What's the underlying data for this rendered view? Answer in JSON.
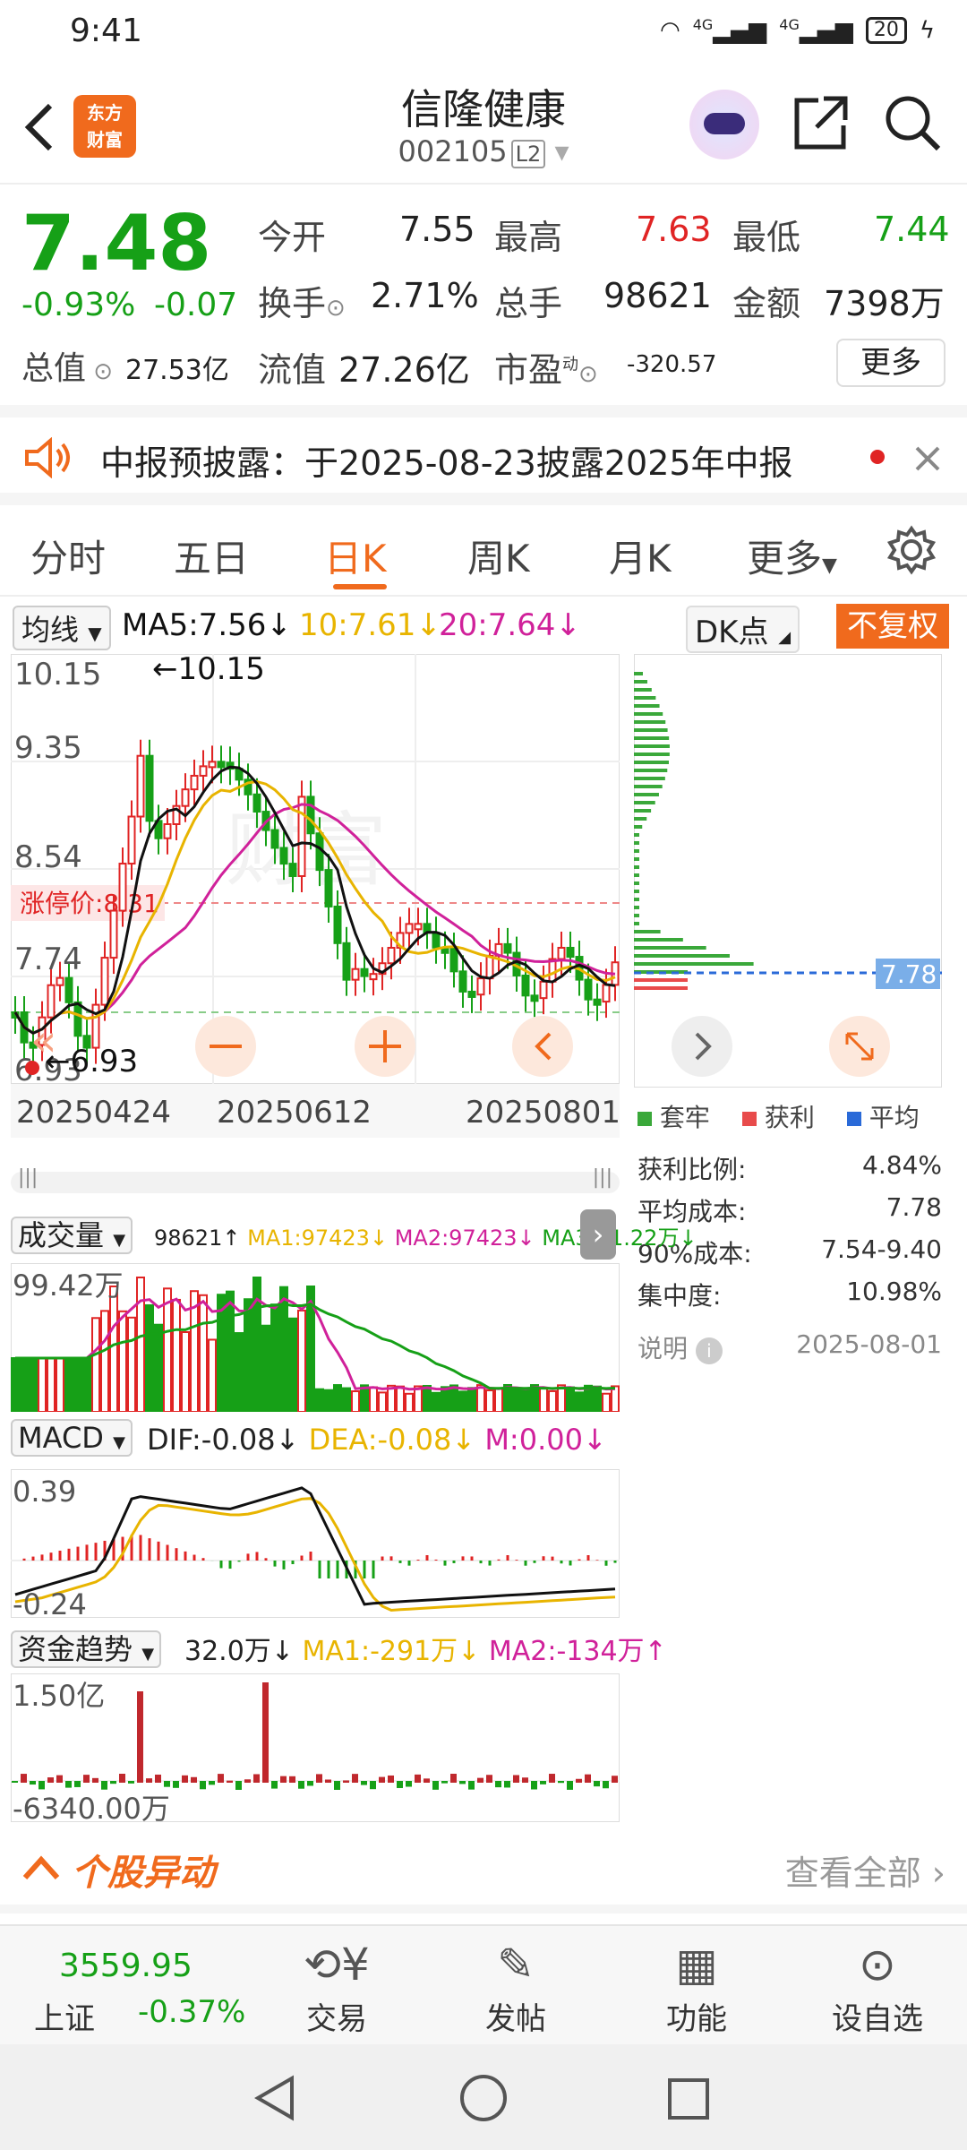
{
  "status": {
    "time": "9:41",
    "net1": "4G",
    "net2": "4G",
    "battery": "20"
  },
  "header": {
    "title": "信隆健康",
    "code": "002105",
    "level": "L2",
    "logo": "东方\n财富"
  },
  "quote": {
    "price": "7.48",
    "change_pct": "-0.93%",
    "change": "-0.07",
    "open_label": "今开",
    "open": "7.55",
    "high_label": "最高",
    "high": "7.63",
    "low_label": "最低",
    "low": "7.44",
    "turnover_label": "换手",
    "turnover": "2.71%",
    "volume_label": "总手",
    "volume": "98621",
    "amount_label": "金额",
    "amount": "7398万",
    "mktcap_label": "总值",
    "mktcap": "27.53亿",
    "float_label": "流值",
    "float": "27.26亿",
    "pe_label": "市盈",
    "pe_sup": "动",
    "pe": "-320.57",
    "more": "更多"
  },
  "notice": {
    "text": "中报预披露：于2025-08-23披露2025年中报"
  },
  "tabs": [
    "分时",
    "五日",
    "日K",
    "周K",
    "月K",
    "更多"
  ],
  "tab_active": 2,
  "kline": {
    "ma_selector": "均线",
    "ma5": "MA5:7.56↓",
    "ma10": "10:7.61↓",
    "ma20": "20:7.64↓",
    "dk": "DK点",
    "fq": "不复权",
    "y_labels": [
      "10.15",
      "9.35",
      "8.54",
      "7.74",
      "6.93"
    ],
    "max_marker": "←10.15",
    "min_marker": "←6.93",
    "limit_label": "涨停价:8.31",
    "dates": [
      "20250424",
      "20250612",
      "20250801"
    ],
    "watermark": "财富"
  },
  "chip": {
    "price_tag": "7.78",
    "legend": [
      "套牢",
      "获利",
      "平均"
    ],
    "rows": [
      {
        "label": "获利比例:",
        "value": "4.84%"
      },
      {
        "label": "平均成本:",
        "value": "7.78"
      },
      {
        "label": "90%成本:",
        "value": "7.54-9.40"
      },
      {
        "label": "集中度:",
        "value": "10.98%"
      }
    ],
    "note": "说明",
    "date": "2025-08-01"
  },
  "volume": {
    "selector": "成交量",
    "val": "98621↑",
    "ma1": "MA1:97423↓",
    "ma2": "MA2:97423↓",
    "ma3": "MA3:11.22万↓",
    "y_label": "99.42万"
  },
  "macd": {
    "selector": "MACD",
    "dif": "DIF:-0.08↓",
    "dea": "DEA:-0.08↓",
    "m": "M:0.00↓",
    "y_top": "0.39",
    "y_bottom": "-0.24"
  },
  "fund": {
    "selector": "资金趋势",
    "val": "32.0万↓",
    "ma1": "MA1:-291万↓",
    "ma2": "MA2:-134万↑",
    "y_top": "1.50亿",
    "y_bottom": "-6340.00万"
  },
  "movement": {
    "title": "个股异动",
    "view_all": "查看全部"
  },
  "bottom": {
    "index_value": "3559.95",
    "index_name": "上证",
    "index_change": "-0.37%",
    "items": [
      "交易",
      "发帖",
      "功能",
      "设自选"
    ]
  },
  "colors": {
    "up": "#e02424",
    "down": "#16a017",
    "accent": "#f06a1d",
    "ma5": "#111111",
    "ma10": "#e8b400",
    "ma20": "#d0219a"
  }
}
